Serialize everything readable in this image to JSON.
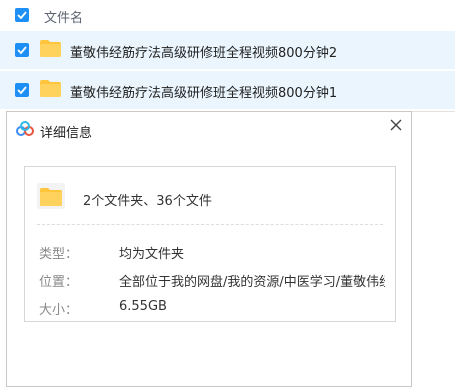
{
  "file_list": {
    "header_label": "文件名",
    "rows": [
      {
        "name": "董敬伟经筋疗法高级研修班全程视频800分钟2"
      },
      {
        "name": "董敬伟经筋疗法高级研修班全程视频800分钟1"
      }
    ]
  },
  "dialog": {
    "title": "详细信息",
    "summary": "2个文件夹、36个文件",
    "type_label": "类型：",
    "type_value": "均为文件夹",
    "location_label": "位置：",
    "location_value": "全部位于我的网盘/我的资源/中医学习/董敬伟经...",
    "size_label": "大小：",
    "size_value": "6.55GB"
  },
  "colors": {
    "checkbox": "#1e90f5",
    "row_selected": "#eaf5fd",
    "folder": "#ffc53d"
  },
  "icons": {
    "checkbox": "check-icon",
    "folder": "folder-icon",
    "app": "app-logo-icon",
    "close": "close-icon"
  }
}
